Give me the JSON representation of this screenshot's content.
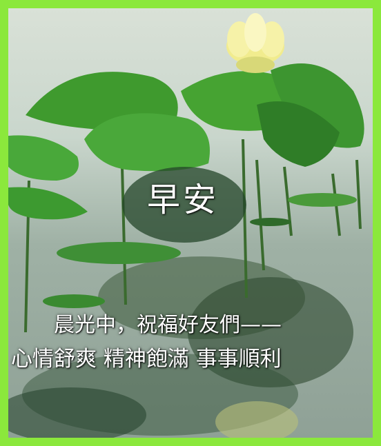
{
  "greeting": "早安",
  "message": {
    "line1": "晨光中，祝福好友們——",
    "line2": "心情舒爽 精神飽滿 事事順利"
  },
  "colors": {
    "border": "#8be83c",
    "leaf": "#3f9a2e",
    "flower": "#f4ef9a"
  }
}
